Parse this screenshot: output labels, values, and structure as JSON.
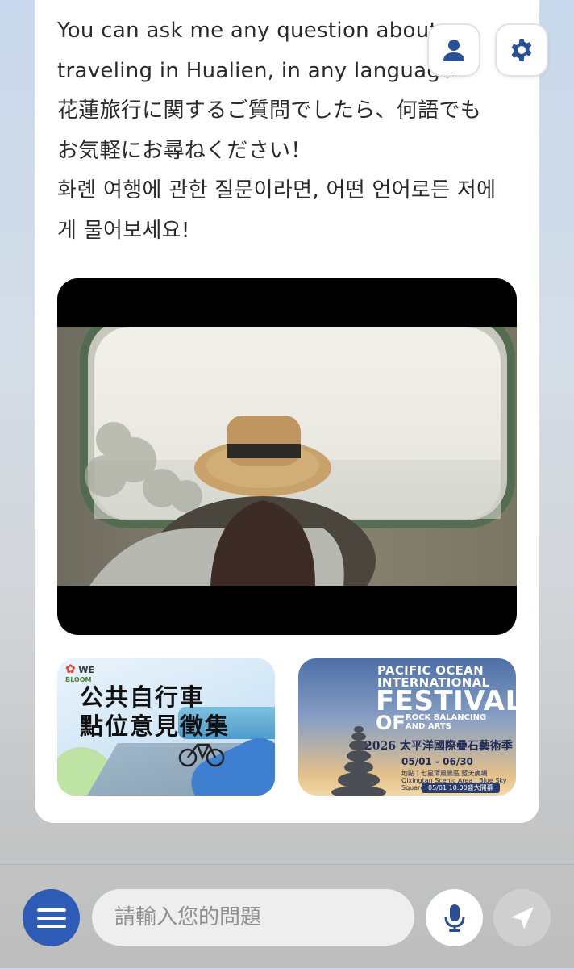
{
  "message": {
    "lines": [
      "You can ask me any question about",
      "traveling in Hualien, in any language.",
      "花蓮旅行に関するご質問でしたら、何語でも",
      "お気軽にお尋ねください！",
      "화롄 여행에 관한 질문이라면, 어떤 언어로든 저에",
      "게 물어보세요!"
    ]
  },
  "banners": {
    "bike": {
      "logo": "WE",
      "logo_sub": "BLOOM",
      "title_line1": "公共自行車",
      "title_line2": "點位意見徵集"
    },
    "festival": {
      "head_line1": "PACIFIC OCEAN",
      "head_line2": "INTERNATIONAL",
      "big": "FESTIVAL",
      "of": "OF",
      "sub_line1": "ROCK BALANCING",
      "sub_line2": "AND ARTS",
      "cn": "2026 太平洋國際疊石藝術季",
      "date": "05/01 - 06/30",
      "place_cn": "地點｜七星潭風景區 藍天廣場",
      "place_en": "Qixingtan Scenic Area | Blue Sky Square",
      "open": "05/01 10:00盛大開幕"
    }
  },
  "input": {
    "placeholder": "請輸入您的問題"
  },
  "icons": {
    "user": "user-icon",
    "settings": "gear-icon",
    "menu": "menu-icon",
    "mic": "microphone-icon",
    "send": "send-icon"
  },
  "colors": {
    "accent": "#2d5bb6",
    "icon": "#2b4f96"
  }
}
